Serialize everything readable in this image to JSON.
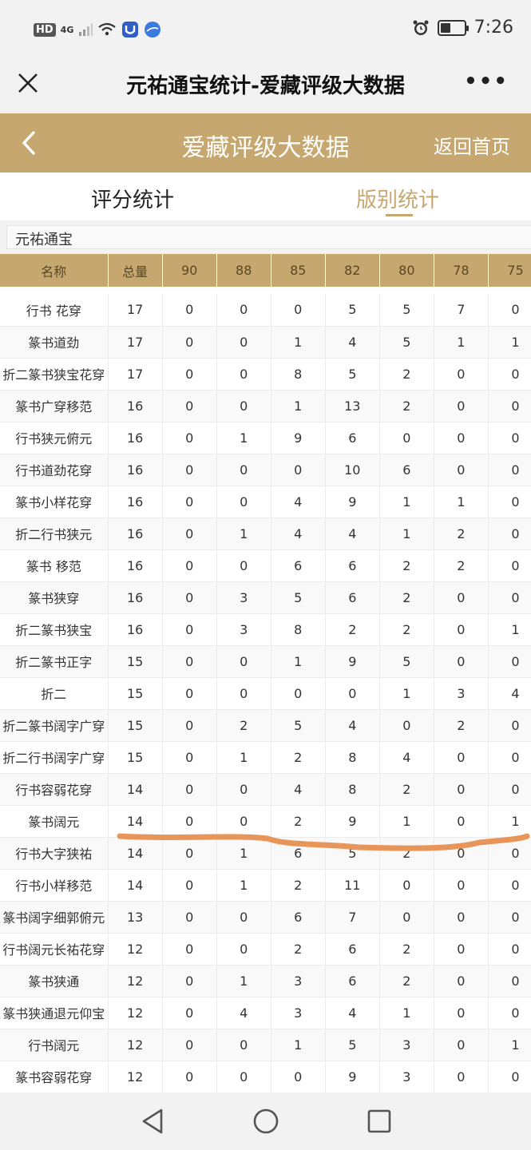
{
  "status_bar": {
    "hd": "HD",
    "network": "4G",
    "time": "7:26",
    "battery_level": 0.45
  },
  "wechat_bar": {
    "title": "元祐通宝统计-爱藏评级大数据",
    "more": "•••"
  },
  "app_header": {
    "title": "爱藏评级大数据",
    "home_link": "返回首页",
    "accent_color": "#c6a76f"
  },
  "tabs": [
    {
      "label": "评分统计",
      "active": false
    },
    {
      "label": "版别统计",
      "active": true
    }
  ],
  "coin_label": "元祐通宝",
  "table": {
    "headers": [
      "名称",
      "总量",
      "90",
      "88",
      "85",
      "82",
      "80",
      "78",
      "75"
    ],
    "rows": [
      [
        "行书 花穿",
        "17",
        "0",
        "0",
        "0",
        "5",
        "5",
        "7",
        "0"
      ],
      [
        "篆书道劲",
        "17",
        "0",
        "0",
        "1",
        "4",
        "5",
        "1",
        "1"
      ],
      [
        "折二篆书狭宝花穿",
        "17",
        "0",
        "0",
        "8",
        "5",
        "2",
        "0",
        "0"
      ],
      [
        "篆书广穿移范",
        "16",
        "0",
        "0",
        "1",
        "13",
        "2",
        "0",
        "0"
      ],
      [
        "行书狭元俯元",
        "16",
        "0",
        "1",
        "9",
        "6",
        "0",
        "0",
        "0"
      ],
      [
        "行书道劲花穿",
        "16",
        "0",
        "0",
        "0",
        "10",
        "6",
        "0",
        "0"
      ],
      [
        "篆书小样花穿",
        "16",
        "0",
        "0",
        "4",
        "9",
        "1",
        "1",
        "0"
      ],
      [
        "折二行书狭元",
        "16",
        "0",
        "1",
        "4",
        "4",
        "1",
        "2",
        "0"
      ],
      [
        "篆书 移范",
        "16",
        "0",
        "0",
        "6",
        "6",
        "2",
        "2",
        "0"
      ],
      [
        "篆书狭穿",
        "16",
        "0",
        "3",
        "5",
        "6",
        "2",
        "0",
        "0"
      ],
      [
        "折二篆书狭宝",
        "16",
        "0",
        "3",
        "8",
        "2",
        "2",
        "0",
        "1"
      ],
      [
        "折二篆书正字",
        "15",
        "0",
        "0",
        "1",
        "9",
        "5",
        "0",
        "0"
      ],
      [
        "折二",
        "15",
        "0",
        "0",
        "0",
        "0",
        "1",
        "3",
        "4"
      ],
      [
        "折二篆书阔字广穿",
        "15",
        "0",
        "2",
        "5",
        "4",
        "0",
        "2",
        "0"
      ],
      [
        "折二行书阔字广穿",
        "15",
        "0",
        "1",
        "2",
        "8",
        "4",
        "0",
        "0"
      ],
      [
        "行书容弱花穿",
        "14",
        "0",
        "0",
        "4",
        "8",
        "2",
        "0",
        "0"
      ],
      [
        "篆书阔元",
        "14",
        "0",
        "0",
        "2",
        "9",
        "1",
        "0",
        "1"
      ],
      [
        "行书大字狭祐",
        "14",
        "0",
        "1",
        "6",
        "5",
        "2",
        "0",
        "0"
      ],
      [
        "行书小样移范",
        "14",
        "0",
        "1",
        "2",
        "11",
        "0",
        "0",
        "0"
      ],
      [
        "篆书阔字细郭俯元",
        "13",
        "0",
        "0",
        "6",
        "7",
        "0",
        "0",
        "0"
      ],
      [
        "行书阔元长祐花穿",
        "12",
        "0",
        "0",
        "2",
        "6",
        "2",
        "0",
        "0"
      ],
      [
        "篆书狭通",
        "12",
        "0",
        "1",
        "3",
        "6",
        "2",
        "0",
        "0"
      ],
      [
        "篆书狭通退元仰宝",
        "12",
        "0",
        "4",
        "3",
        "4",
        "1",
        "0",
        "0"
      ],
      [
        "行书阔元",
        "12",
        "0",
        "0",
        "1",
        "5",
        "3",
        "0",
        "1"
      ],
      [
        "篆书容弱花穿",
        "12",
        "0",
        "0",
        "0",
        "9",
        "3",
        "0",
        "0"
      ]
    ]
  },
  "annotation_color": "#e8955a"
}
